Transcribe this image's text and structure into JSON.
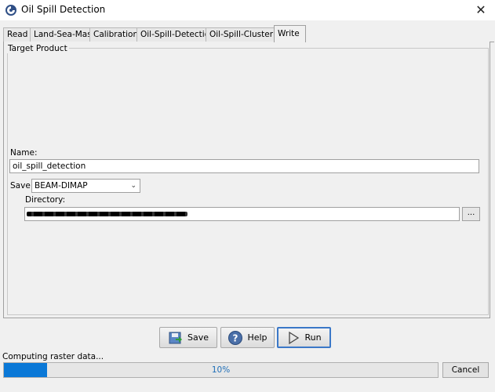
{
  "window": {
    "title": "Oil Spill Detection",
    "close_glyph": "✕",
    "icon": "app-logo-icon"
  },
  "tabs": [
    {
      "label": "Read"
    },
    {
      "label": "Land-Sea-Mask"
    },
    {
      "label": "Calibration"
    },
    {
      "label": "Oil-Spill-Detection"
    },
    {
      "label": "Oil-Spill-Clustering"
    },
    {
      "label": "Write",
      "active": true
    }
  ],
  "target": {
    "group_title": "Target Product",
    "name_label": "Name:",
    "name_value": "oil_spill_detection",
    "save_as_label": "Save as:",
    "save_as_value": "BEAM-DIMAP",
    "directory_label": "Directory:",
    "browse_label": "..."
  },
  "buttons": {
    "save": "Save",
    "help": "Help",
    "run": "Run"
  },
  "status": {
    "text": "Computing raster data...",
    "progress_percent": 10,
    "progress_label": "10%",
    "cancel": "Cancel"
  },
  "colors": {
    "progress": "#0a78d7",
    "focus": "#3b78c8"
  }
}
